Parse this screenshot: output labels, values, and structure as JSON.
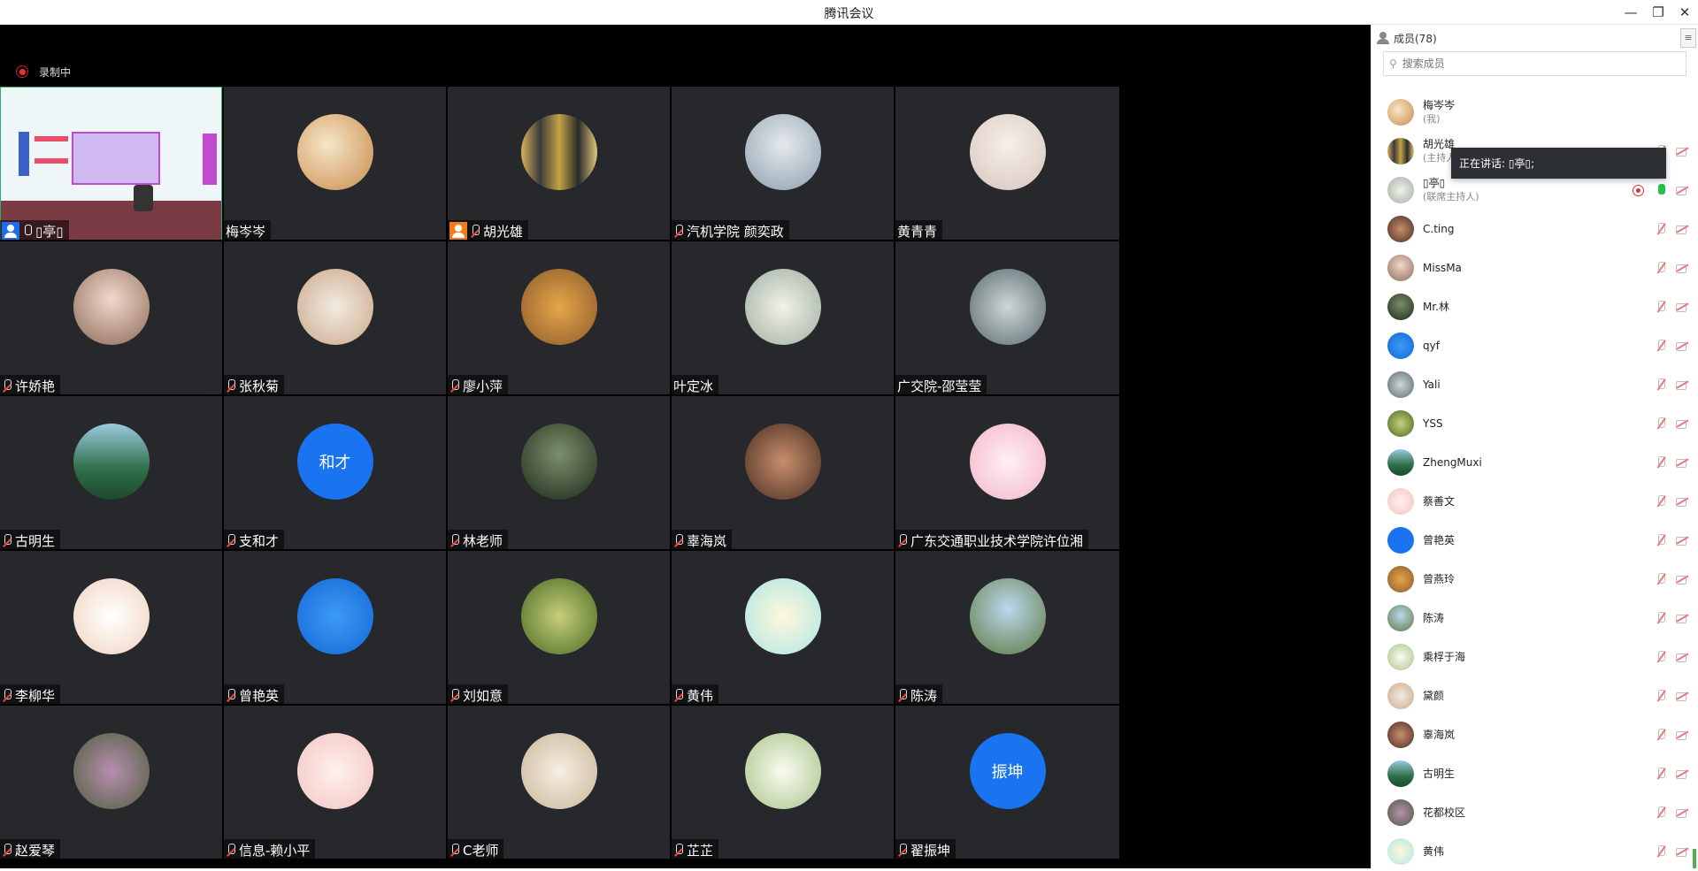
{
  "window": {
    "title": "腾讯会议",
    "minimize": "—",
    "restore": "❐",
    "close": "✕"
  },
  "recording": {
    "label": "录制中"
  },
  "tiles": [
    {
      "name": "▯亭▯",
      "avatar": "screen-share",
      "mic": "on",
      "badge": "blue"
    },
    {
      "name": "梅岑岑",
      "avatar": "c1",
      "mic": "none"
    },
    {
      "name": "胡光雄",
      "avatar": "c2",
      "mic": "off",
      "badge": "orange"
    },
    {
      "name": "汽机学院 颜奕政",
      "avatar": "c3",
      "mic": "off"
    },
    {
      "name": "黄青青",
      "avatar": "c4",
      "mic": "none"
    },
    {
      "name": "许娇艳",
      "avatar": "c5",
      "mic": "off"
    },
    {
      "name": "张秋菊",
      "avatar": "c6",
      "mic": "off"
    },
    {
      "name": "廖小萍",
      "avatar": "c7",
      "mic": "off"
    },
    {
      "name": "叶定冰",
      "avatar": "c8",
      "mic": "none"
    },
    {
      "name": "广交院-邵莹莹",
      "avatar": "c9",
      "mic": "none"
    },
    {
      "name": "古明生",
      "avatar": "c10",
      "mic": "off"
    },
    {
      "name": "支和才",
      "avatar": "c11",
      "mic": "off",
      "avatar_text": "和才"
    },
    {
      "name": "林老师",
      "avatar": "c12",
      "mic": "off"
    },
    {
      "name": "辜海岚",
      "avatar": "c13",
      "mic": "off"
    },
    {
      "name": "广东交通职业技术学院许位湘",
      "avatar": "c14",
      "mic": "off"
    },
    {
      "name": "李柳华",
      "avatar": "c15",
      "mic": "off"
    },
    {
      "name": "曾艳英",
      "avatar": "c16",
      "mic": "off"
    },
    {
      "name": "刘如意",
      "avatar": "c17",
      "mic": "off"
    },
    {
      "name": "黄伟",
      "avatar": "c18",
      "mic": "off"
    },
    {
      "name": "陈涛",
      "avatar": "c19",
      "mic": "off"
    },
    {
      "name": "赵爱琴",
      "avatar": "c20",
      "mic": "off"
    },
    {
      "name": "信息-赖小平",
      "avatar": "c21",
      "mic": "off"
    },
    {
      "name": "C老师",
      "avatar": "c22",
      "mic": "off"
    },
    {
      "name": "芷芷",
      "avatar": "c23",
      "mic": "off"
    },
    {
      "name": "翟振坤",
      "avatar": "c11",
      "mic": "off",
      "avatar_text": "振坤"
    }
  ],
  "panel": {
    "title": "成员(78)",
    "menu_icon": "≡",
    "search_placeholder": "搜索成员",
    "members": [
      {
        "name": "梅岑岑",
        "role": "(我)",
        "avatar": "c1",
        "icons": "none"
      },
      {
        "name": "胡光雄",
        "role": "(主持人)",
        "avatar": "c2",
        "icons": "off"
      },
      {
        "name": "▯亭▯",
        "role": "(联席主持人)",
        "avatar": "c8",
        "icons": "live"
      },
      {
        "name": "C.ting",
        "role": "",
        "avatar": "c13",
        "icons": "off"
      },
      {
        "name": "MissMa",
        "role": "",
        "avatar": "c5",
        "icons": "off"
      },
      {
        "name": "Mr.林",
        "role": "",
        "avatar": "c12",
        "icons": "off"
      },
      {
        "name": "qyf",
        "role": "",
        "avatar": "c16",
        "icons": "off"
      },
      {
        "name": "Yali",
        "role": "",
        "avatar": "c9",
        "icons": "off"
      },
      {
        "name": "YSS",
        "role": "",
        "avatar": "c17",
        "icons": "off"
      },
      {
        "name": "ZhengMuxi",
        "role": "",
        "avatar": "c10",
        "icons": "off"
      },
      {
        "name": "蔡善文",
        "role": "",
        "avatar": "c21",
        "icons": "off"
      },
      {
        "name": "曾艳英",
        "role": "",
        "avatar": "c11",
        "icons": "off"
      },
      {
        "name": "曾燕玲",
        "role": "",
        "avatar": "c7",
        "icons": "off"
      },
      {
        "name": "陈涛",
        "role": "",
        "avatar": "c19",
        "icons": "off"
      },
      {
        "name": "乘桴于海",
        "role": "",
        "avatar": "c23",
        "icons": "off"
      },
      {
        "name": "黛颜",
        "role": "",
        "avatar": "c6",
        "icons": "off"
      },
      {
        "name": "辜海岚",
        "role": "",
        "avatar": "c13",
        "icons": "off"
      },
      {
        "name": "古明生",
        "role": "",
        "avatar": "c10",
        "icons": "off"
      },
      {
        "name": "花都校区",
        "role": "",
        "avatar": "c20",
        "icons": "off"
      },
      {
        "name": "黄伟",
        "role": "",
        "avatar": "c18",
        "icons": "off"
      }
    ]
  },
  "tooltip": {
    "text": "正在讲话: ▯亭▯;"
  },
  "colors": {
    "stage_bg": "#000000",
    "tile_bg": "#26282c",
    "accent": "#1a73f0",
    "recording": "#e33333",
    "speaking": "#2bbd4b"
  }
}
